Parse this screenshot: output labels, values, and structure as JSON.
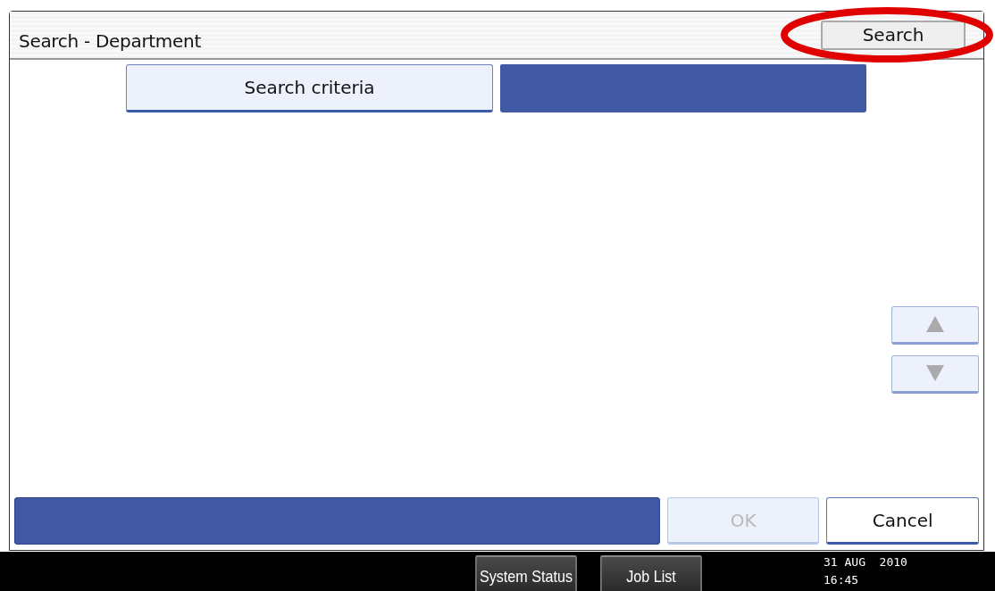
{
  "window": {
    "title": "Search - Department",
    "search_button": "Search"
  },
  "criteria_button": "Search criteria",
  "scroll_buttons": [
    {
      "kind": "up",
      "disabled": true
    },
    {
      "kind": "down",
      "disabled": true
    }
  ],
  "actions": [
    {
      "label": "OK",
      "disabled": true
    },
    {
      "label": "Cancel",
      "disabled": false
    }
  ],
  "status_bar": {
    "buttons": [
      "System Status",
      "Job List"
    ],
    "date": "31 AUG  2010",
    "time": "16:45"
  }
}
